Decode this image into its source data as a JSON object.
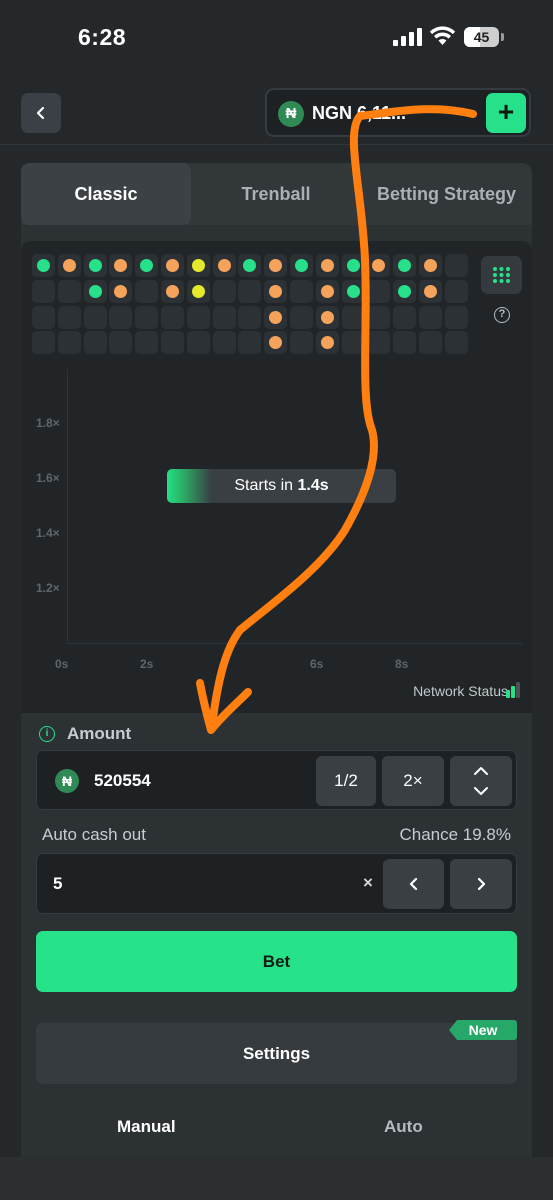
{
  "status_bar": {
    "time": "6:28",
    "battery": "45",
    "battery_level_percent": 45
  },
  "header": {
    "wallet_text": "NGN 6,11..."
  },
  "tabs": [
    {
      "label": "Classic",
      "active": true
    },
    {
      "label": "Trenball",
      "active": false
    },
    {
      "label": "Betting Strategy",
      "active": false
    }
  ],
  "history": {
    "colors": {
      "green": "#27e08a",
      "orange": "#f5a35a",
      "yellow": "#e4ea2b",
      "empty": "#2c3135"
    },
    "rows": [
      [
        "green",
        "orange",
        "green",
        "orange",
        "green",
        "orange",
        "yellow",
        "orange",
        "green",
        "orange",
        "green",
        "orange",
        "green",
        "orange",
        "green",
        "orange",
        ""
      ],
      [
        "",
        "",
        "green",
        "orange",
        "",
        "orange",
        "yellow",
        "",
        "",
        "orange",
        "",
        "orange",
        "green",
        "",
        "green",
        "orange",
        ""
      ],
      [
        "",
        "",
        "",
        "",
        "",
        "",
        "",
        "",
        "",
        "orange",
        "",
        "orange",
        "",
        "",
        "",
        "",
        ""
      ],
      [
        "",
        "",
        "",
        "",
        "",
        "",
        "",
        "",
        "",
        "orange",
        "",
        "orange",
        "",
        "",
        "",
        "",
        ""
      ]
    ]
  },
  "chart": {
    "y_ticks": [
      "1.8×",
      "1.6×",
      "1.4×",
      "1.2×"
    ],
    "x_ticks": [
      "0s",
      "2s",
      "6s",
      "8s"
    ],
    "countdown_prefix": "Starts in",
    "countdown_value": "1.4s",
    "countdown_progress": 0.19,
    "network_status": "Network Status"
  },
  "bet": {
    "amount_label": "Amount",
    "amount_value": "520554",
    "half_label": "1/2",
    "double_label": "2×",
    "cashout_label": "Auto cash out",
    "chance_label": "Chance 19.8%",
    "cashout_value": "5",
    "clear_label": "×",
    "bet_label": "Bet",
    "settings_label": "Settings",
    "new_badge": "New",
    "manual_label": "Manual",
    "auto_label": "Auto"
  },
  "colors": {
    "accent": "#26e18a",
    "annotation": "#ff7f11"
  }
}
